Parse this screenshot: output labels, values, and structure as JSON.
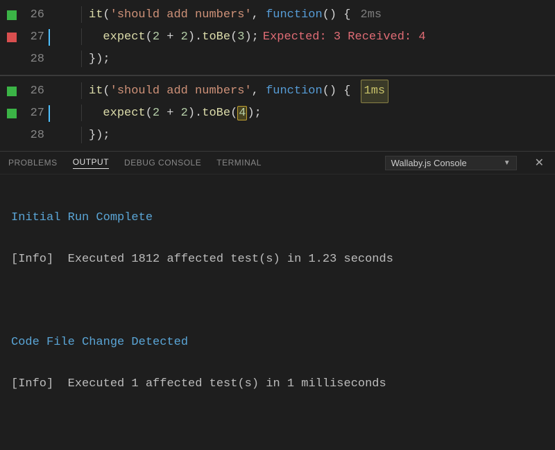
{
  "editor1": {
    "lines": [
      {
        "num": "26",
        "marker": "green",
        "cursor": false,
        "tokens": [
          {
            "cls": "tk-fn",
            "t": "it"
          },
          {
            "cls": "tk-punc",
            "t": "("
          },
          {
            "cls": "tk-str",
            "t": "'should add numbers'"
          },
          {
            "cls": "tk-punc",
            "t": ", "
          },
          {
            "cls": "tk-kw",
            "t": "function"
          },
          {
            "cls": "tk-punc",
            "t": "() {"
          }
        ],
        "suffix": {
          "type": "time",
          "t": "2ms"
        }
      },
      {
        "num": "27",
        "marker": "red",
        "cursor": true,
        "tokens": [
          {
            "cls": "tk-punc",
            "t": "  "
          },
          {
            "cls": "tk-fn",
            "t": "expect"
          },
          {
            "cls": "tk-punc",
            "t": "("
          },
          {
            "cls": "tk-num",
            "t": "2"
          },
          {
            "cls": "tk-plain",
            "t": " + "
          },
          {
            "cls": "tk-num",
            "t": "2"
          },
          {
            "cls": "tk-punc",
            "t": ")."
          },
          {
            "cls": "tk-fn",
            "t": "toBe"
          },
          {
            "cls": "tk-punc",
            "t": "("
          },
          {
            "cls": "tk-num",
            "t": "3"
          },
          {
            "cls": "tk-punc",
            "t": ");"
          }
        ],
        "suffix": {
          "type": "err",
          "t": "Expected: 3 Received: 4"
        }
      },
      {
        "num": "28",
        "marker": "",
        "cursor": false,
        "tokens": [
          {
            "cls": "tk-punc",
            "t": "});"
          }
        ],
        "suffix": null
      }
    ]
  },
  "editor2": {
    "lines": [
      {
        "num": "26",
        "marker": "green",
        "cursor": false,
        "tokens": [
          {
            "cls": "tk-fn",
            "t": "it"
          },
          {
            "cls": "tk-punc",
            "t": "("
          },
          {
            "cls": "tk-str",
            "t": "'should add numbers'"
          },
          {
            "cls": "tk-punc",
            "t": ", "
          },
          {
            "cls": "tk-kw",
            "t": "function"
          },
          {
            "cls": "tk-punc",
            "t": "() {"
          }
        ],
        "suffix": {
          "type": "time-hl",
          "t": "1ms"
        }
      },
      {
        "num": "27",
        "marker": "green",
        "cursor": true,
        "tokens": [
          {
            "cls": "tk-punc",
            "t": "  "
          },
          {
            "cls": "tk-fn",
            "t": "expect"
          },
          {
            "cls": "tk-punc",
            "t": "("
          },
          {
            "cls": "tk-num",
            "t": "2"
          },
          {
            "cls": "tk-plain",
            "t": " + "
          },
          {
            "cls": "tk-num",
            "t": "2"
          },
          {
            "cls": "tk-punc",
            "t": ")."
          },
          {
            "cls": "tk-fn",
            "t": "toBe"
          },
          {
            "cls": "tk-punc",
            "t": "("
          },
          {
            "cls": "tk-num",
            "t": "4",
            "box": true
          },
          {
            "cls": "tk-punc",
            "t": ");"
          }
        ],
        "suffix": null
      },
      {
        "num": "28",
        "marker": "",
        "cursor": false,
        "tokens": [
          {
            "cls": "tk-punc",
            "t": "});"
          }
        ],
        "suffix": null
      }
    ]
  },
  "panel": {
    "tabs": {
      "problems": "PROBLEMS",
      "output": "OUTPUT",
      "debug": "DEBUG CONSOLE",
      "terminal": "TERMINAL"
    },
    "dropdown": "Wallaby.js Console"
  },
  "console": {
    "l1": "Initial Run Complete",
    "l2_info": "[Info]",
    "l2_rest": "  Executed 1812 affected test(s) in 1.23 seconds",
    "l3": "Code File Change Detected",
    "l4_info": "[Info]",
    "l4_rest": "  Executed 1 affected test(s) in 1 milliseconds"
  }
}
